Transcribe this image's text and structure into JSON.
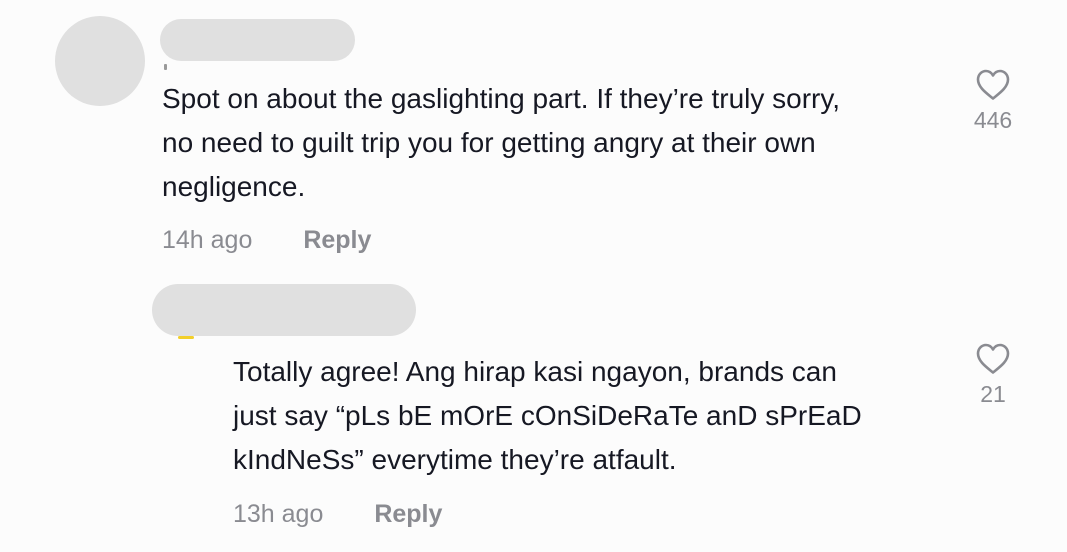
{
  "comments": [
    {
      "author_redacted": true,
      "text_lines": [
        "Spot on about the gaslighting part. If they’re truly sorry,",
        "no need to guilt trip you for getting angry at their own",
        "negligence."
      ],
      "timestamp": "14h ago",
      "reply_label": "Reply",
      "like_count": "446",
      "like_icon": "heart-outline-icon"
    },
    {
      "author_redacted": true,
      "is_reply": true,
      "text_lines": [
        "Totally agree! Ang hirap kasi ngayon, brands can",
        "just say “pLs bE mOrE cOnSiDeRaTe anD sPrEaD",
        "kIndNeSs” everytime they’re atfault."
      ],
      "timestamp": "13h ago",
      "reply_label": "Reply",
      "like_count": "21",
      "like_icon": "heart-outline-icon"
    }
  ],
  "colors": {
    "text": "#161823",
    "muted": "#8a8b91",
    "redaction": "#e0e0e0",
    "background": "#fcfcfc"
  }
}
